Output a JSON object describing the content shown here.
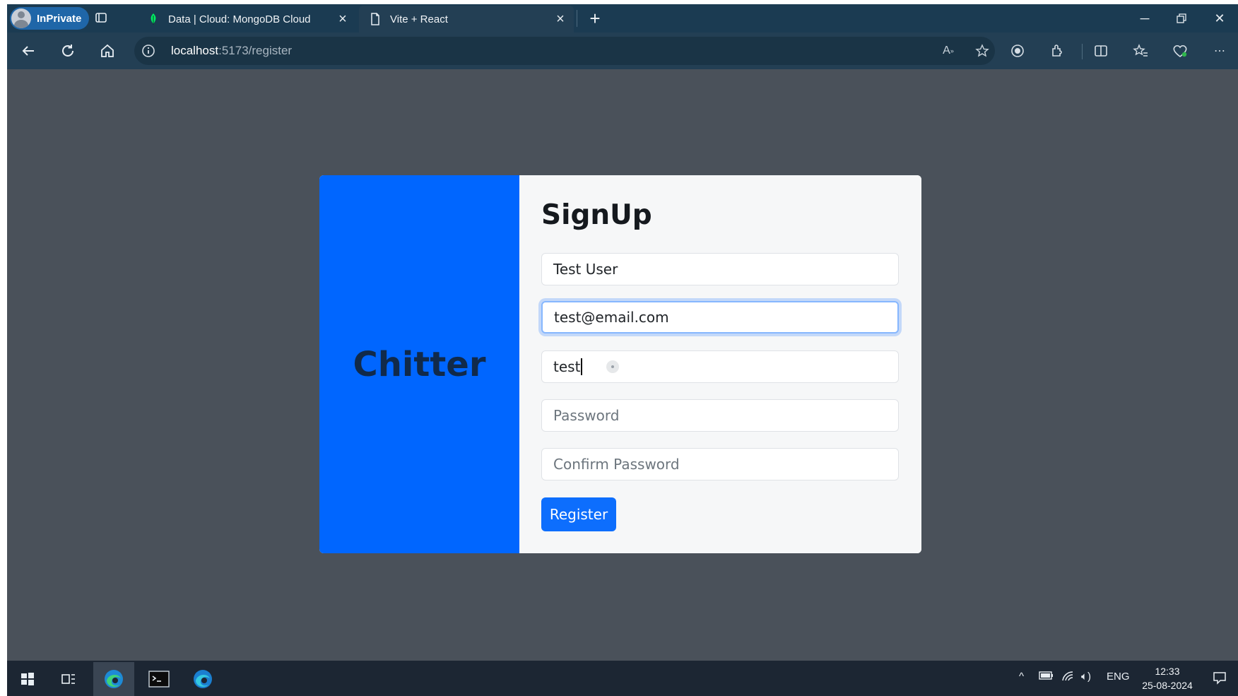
{
  "browser": {
    "profile_badge": "InPrivate",
    "tabs": [
      {
        "title": "Data | Cloud: MongoDB Cloud",
        "favicon": "mongodb-leaf-icon",
        "active": false
      },
      {
        "title": "Vite + React",
        "favicon": "page-icon",
        "active": true
      }
    ],
    "address": {
      "host": "localhost",
      "path": ":5173/register"
    }
  },
  "signup": {
    "brand": "Chitter",
    "title": "SignUp",
    "fields": {
      "full_name": {
        "value": "Test User",
        "placeholder": ""
      },
      "email": {
        "value": "test@email.com",
        "placeholder": ""
      },
      "username": {
        "value": "test",
        "placeholder": ""
      },
      "password": {
        "value": "",
        "placeholder": "Password"
      },
      "confirm_password": {
        "value": "",
        "placeholder": "Confirm Password"
      }
    },
    "register_label": "Register"
  },
  "taskbar": {
    "language": "ENG",
    "time": "12:33",
    "date": "25-08-2024"
  },
  "colors": {
    "brand_panel": "#0066ff",
    "register_button": "#0d6efd",
    "page_background": "#4a515a",
    "tab_strip": "#1b3b52",
    "toolbar": "#233f54"
  }
}
